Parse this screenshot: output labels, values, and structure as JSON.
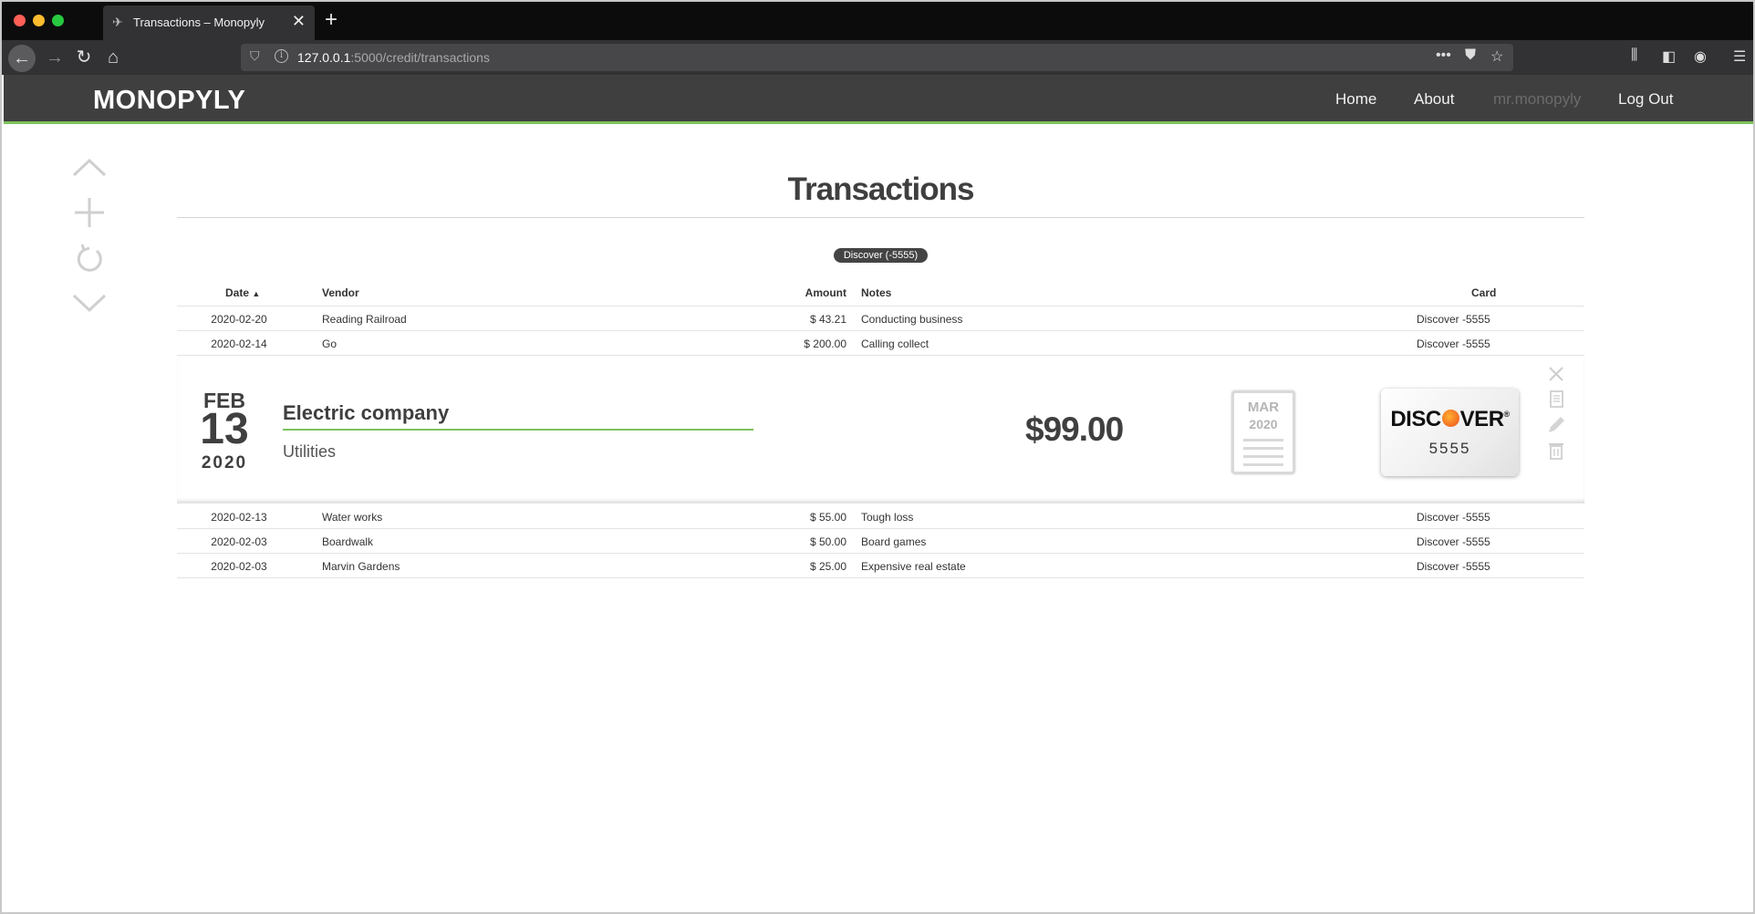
{
  "browser": {
    "tab_title": "Transactions – Monopyly",
    "url_host": "127.0.0.1",
    "url_path": ":5000/credit/transactions",
    "new_tab_label": "+"
  },
  "header": {
    "brand": "MONOPYLY",
    "nav": [
      "Home",
      "About",
      "mr.monopyly",
      "Log Out"
    ]
  },
  "page": {
    "title": "Transactions",
    "filter_pill": "Discover (-5555)"
  },
  "table": {
    "columns": [
      "Date",
      "Vendor",
      "Amount",
      "Notes",
      "Card"
    ],
    "sort_indicator": "▲",
    "rows_before": [
      {
        "date": "2020-02-20",
        "vendor": "Reading Railroad",
        "amount": "$ 43.21",
        "notes": "Conducting business",
        "card": "Discover -5555"
      },
      {
        "date": "2020-02-14",
        "vendor": "Go",
        "amount": "$ 200.00",
        "notes": "Calling collect",
        "card": "Discover -5555"
      }
    ],
    "rows_after": [
      {
        "date": "2020-02-13",
        "vendor": "Water works",
        "amount": "$ 55.00",
        "notes": "Tough loss",
        "card": "Discover -5555"
      },
      {
        "date": "2020-02-03",
        "vendor": "Boardwalk",
        "amount": "$ 50.00",
        "notes": "Board games",
        "card": "Discover -5555"
      },
      {
        "date": "2020-02-03",
        "vendor": "Marvin Gardens",
        "amount": "$ 25.00",
        "notes": "Expensive real estate",
        "card": "Discover -5555"
      }
    ]
  },
  "expanded": {
    "month": "FEB",
    "day": "13",
    "year": "2020",
    "vendor": "Electric company",
    "category": "Utilities",
    "amount": "$99.00",
    "statement_month": "MAR",
    "statement_year": "2020",
    "card_brand_pre": "DISC",
    "card_brand_post": "VER",
    "card_last4": "5555"
  },
  "colors": {
    "accent": "#7dc15b",
    "header_bg": "#3f3f3f",
    "text": "#3f3f3f"
  }
}
